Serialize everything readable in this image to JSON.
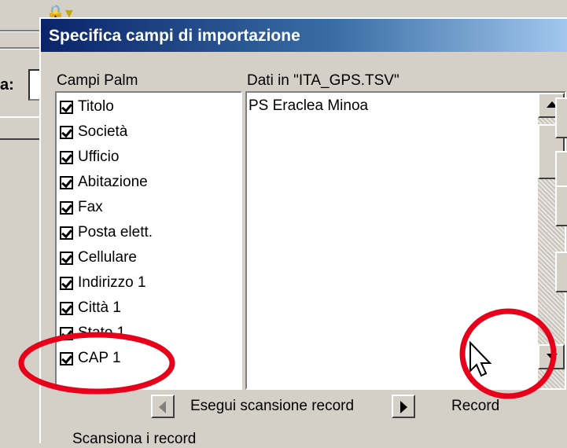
{
  "dialog": {
    "title": "Specifica campi di importazione",
    "left_column_label": "Campi Palm",
    "right_column_label": "Dati in  \"ITA_GPS.TSV\"",
    "data_value": "PS Eraclea Minoa",
    "fields": [
      {
        "label": "Titolo",
        "checked": true
      },
      {
        "label": "Società",
        "checked": true
      },
      {
        "label": "Ufficio",
        "checked": true
      },
      {
        "label": "Abitazione",
        "checked": true
      },
      {
        "label": "Fax",
        "checked": true
      },
      {
        "label": "Posta elett.",
        "checked": true
      },
      {
        "label": "Cellulare",
        "checked": true
      },
      {
        "label": "Indirizzo 1",
        "checked": true
      },
      {
        "label": "Città 1",
        "checked": true
      },
      {
        "label": "Stato 1",
        "checked": true
      },
      {
        "label": "CAP 1",
        "checked": true
      }
    ],
    "scan_label": "Esegui scansione record",
    "record_label": "Record",
    "bottom_label": "Scansiona i record"
  },
  "background": {
    "field_label": "a:"
  },
  "colors": {
    "title_gradient_start": "#0a246a",
    "title_gradient_end": "#a6caf0",
    "annotation": "#e8001a"
  }
}
